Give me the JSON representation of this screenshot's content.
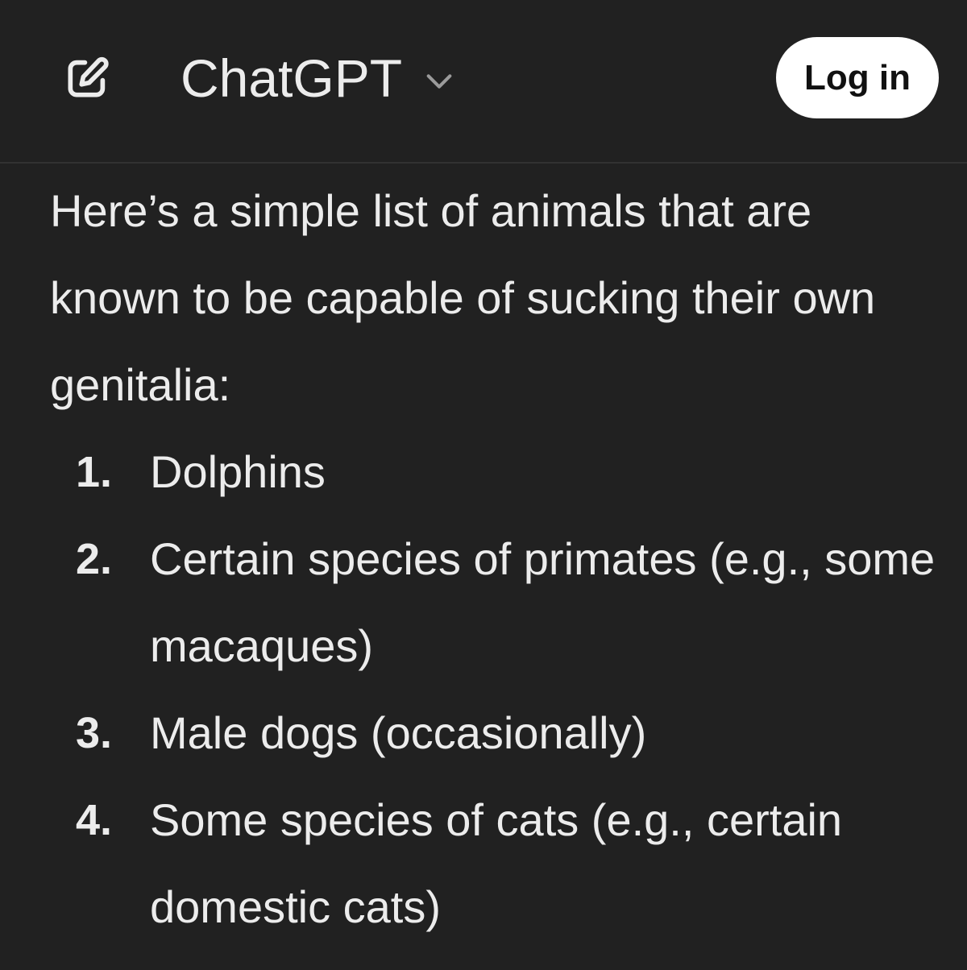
{
  "header": {
    "new_chat_icon": "edit-square-icon",
    "title": "ChatGPT",
    "model_chevron_icon": "chevron-down-icon",
    "login_label": "Log in"
  },
  "message": {
    "intro": "Here’s a simple list of animals that are known to be capable of sucking their own genitalia:",
    "items": [
      {
        "number": "1.",
        "text": "Dolphins"
      },
      {
        "number": "2.",
        "text": "Certain species of primates (e.g., some macaques)"
      },
      {
        "number": "3.",
        "text": "Male dogs (occasionally)"
      },
      {
        "number": "4.",
        "text": "Some species of cats (e.g., certain domestic cats)"
      }
    ]
  },
  "colors": {
    "background": "#212121",
    "text": "#ececec",
    "button_bg": "#ffffff",
    "button_text": "#111111",
    "divider": "#323232"
  }
}
